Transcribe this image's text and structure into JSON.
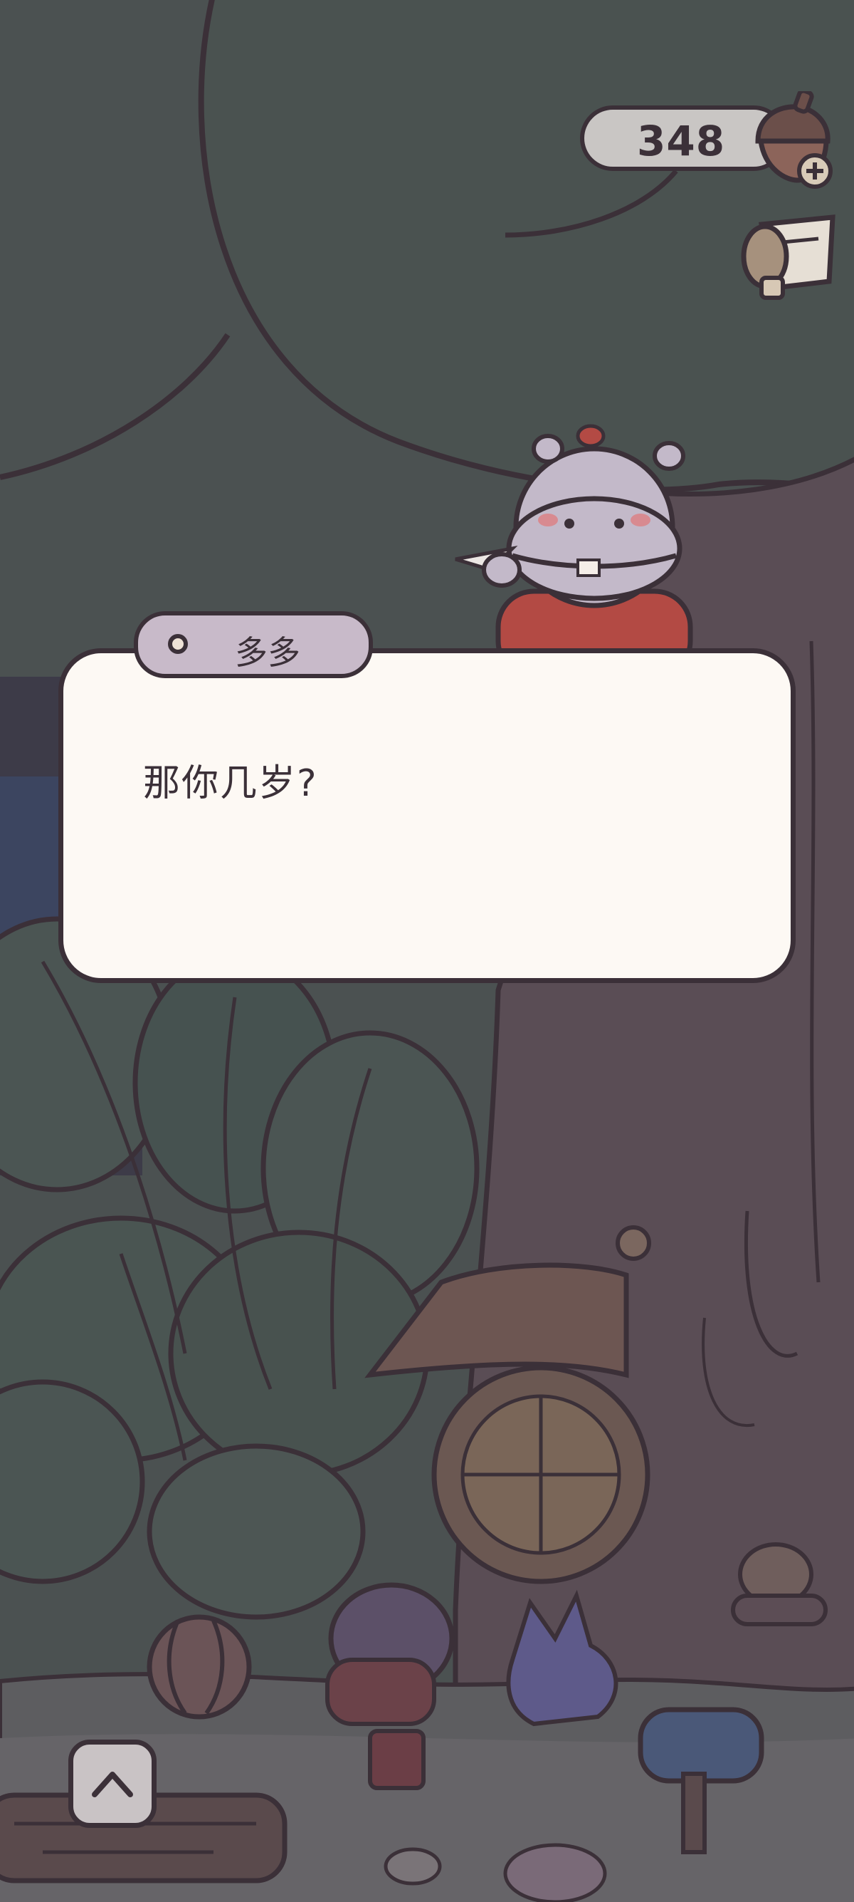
{
  "hud": {
    "acorn_count": "348",
    "currency_icon": "acorn-icon",
    "add_icon": "plus-icon",
    "quest_icon": "scroll-icon"
  },
  "dialog": {
    "speaker": "多多",
    "text": "那你几岁?"
  },
  "controls": {
    "expand_icon": "chevron-up-icon"
  },
  "colors": {
    "outline": "#3b3038",
    "dialog_bg": "#fdf9f4",
    "name_tag_bg": "#c8bac9",
    "foliage_dark": "#4a5350",
    "tree_trunk": "#5a4d55"
  }
}
